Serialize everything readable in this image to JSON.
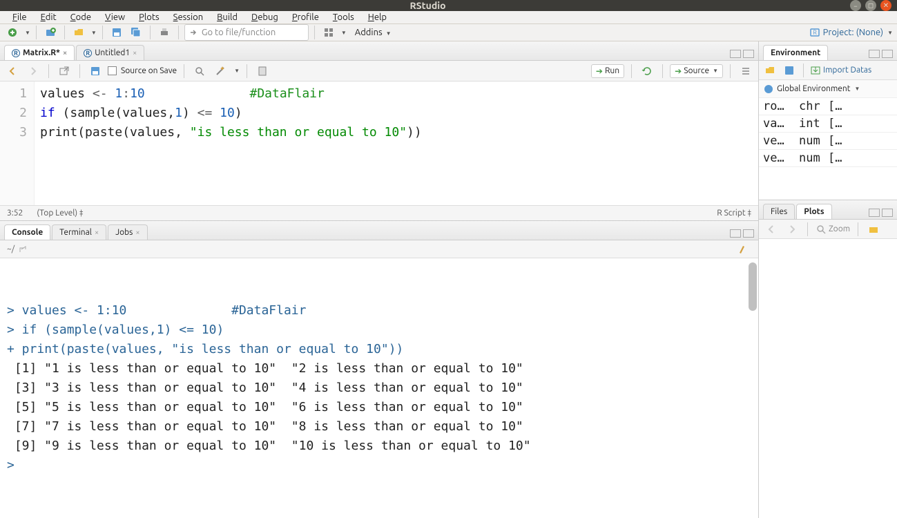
{
  "window": {
    "title": "RStudio"
  },
  "menu": [
    "File",
    "Edit",
    "Code",
    "View",
    "Plots",
    "Session",
    "Build",
    "Debug",
    "Profile",
    "Tools",
    "Help"
  ],
  "toolbar": {
    "goto_placeholder": "Go to file/function",
    "addins_label": "Addins",
    "project_label": "Project: (None)"
  },
  "source": {
    "tabs": [
      {
        "label": "Matrix.R",
        "dirty": true
      },
      {
        "label": "Untitled1",
        "dirty": false
      }
    ],
    "source_on_save": "Source on Save",
    "run_label": "Run",
    "source_label": "Source",
    "cursor_pos": "3:52",
    "scope": "(Top Level)",
    "file_type": "R Script",
    "lines": [
      {
        "n": "1",
        "content": [
          {
            "t": "values ",
            "c": ""
          },
          {
            "t": "<-",
            "c": "tok-op"
          },
          {
            "t": " ",
            "c": ""
          },
          {
            "t": "1",
            "c": "tok-num"
          },
          {
            "t": ":",
            "c": "tok-op"
          },
          {
            "t": "10",
            "c": "tok-num"
          },
          {
            "t": "              ",
            "c": ""
          },
          {
            "t": "#DataFlair",
            "c": "tok-com"
          }
        ]
      },
      {
        "n": "2",
        "content": [
          {
            "t": "if",
            "c": "tok-kw"
          },
          {
            "t": " (",
            "c": ""
          },
          {
            "t": "sample",
            "c": "tok-fun"
          },
          {
            "t": "(values,",
            "c": ""
          },
          {
            "t": "1",
            "c": "tok-num"
          },
          {
            "t": ") ",
            "c": ""
          },
          {
            "t": "<=",
            "c": "tok-op"
          },
          {
            "t": " ",
            "c": ""
          },
          {
            "t": "10",
            "c": "tok-num"
          },
          {
            "t": ")",
            "c": ""
          }
        ]
      },
      {
        "n": "3",
        "content": [
          {
            "t": "print",
            "c": "tok-fun"
          },
          {
            "t": "(",
            "c": ""
          },
          {
            "t": "paste",
            "c": "tok-fun"
          },
          {
            "t": "(values, ",
            "c": ""
          },
          {
            "t": "\"is less than or equal to 10\"",
            "c": "tok-str"
          },
          {
            "t": "))",
            "c": ""
          }
        ]
      }
    ]
  },
  "console": {
    "tabs": [
      "Console",
      "Terminal",
      "Jobs"
    ],
    "prompt_path": "~/",
    "lines": [
      {
        "p": ">",
        "t": " values <- 1:10              #DataFlair",
        "c": "con-code"
      },
      {
        "p": ">",
        "t": " if (sample(values,1) <= 10)",
        "c": "con-code"
      },
      {
        "p": "+",
        "t": " print(paste(values, \"is less than or equal to 10\"))",
        "c": "con-code"
      },
      {
        "p": "",
        "t": " [1] \"1 is less than or equal to 10\"  \"2 is less than or equal to 10\" ",
        "c": "con-out"
      },
      {
        "p": "",
        "t": " [3] \"3 is less than or equal to 10\"  \"4 is less than or equal to 10\" ",
        "c": "con-out"
      },
      {
        "p": "",
        "t": " [5] \"5 is less than or equal to 10\"  \"6 is less than or equal to 10\" ",
        "c": "con-out"
      },
      {
        "p": "",
        "t": " [7] \"7 is less than or equal to 10\"  \"8 is less than or equal to 10\" ",
        "c": "con-out"
      },
      {
        "p": "",
        "t": " [9] \"9 is less than or equal to 10\"  \"10 is less than or equal to 10\"",
        "c": "con-out"
      },
      {
        "p": ">",
        "t": " ",
        "c": "con-code"
      }
    ]
  },
  "environment": {
    "tab_label": "Environment",
    "import_label": "Import Datas",
    "scope_label": "Global Environment",
    "rows": [
      {
        "name": "ro…",
        "type": "chr",
        "val": "[…"
      },
      {
        "name": "va…",
        "type": "int",
        "val": "[…"
      },
      {
        "name": "ve…",
        "type": "num",
        "val": "[…"
      },
      {
        "name": "ve…",
        "type": "num",
        "val": "[…"
      }
    ]
  },
  "plots": {
    "tabs": [
      "Files",
      "Plots"
    ],
    "zoom_label": "Zoom"
  }
}
